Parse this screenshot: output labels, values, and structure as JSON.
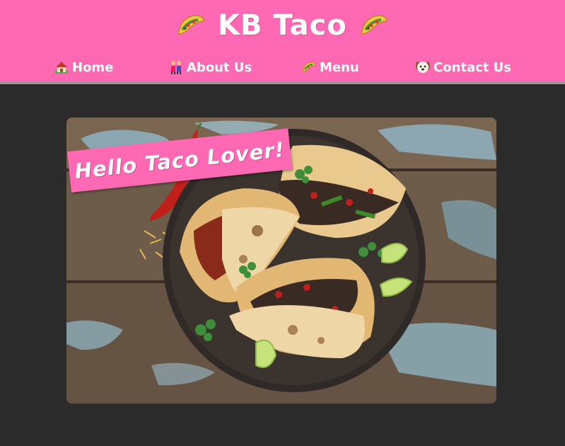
{
  "header": {
    "title": "KB Taco",
    "left_icon": "taco-icon",
    "right_icon": "taco-icon",
    "background_color": "#ff69b4"
  },
  "nav": {
    "items": [
      {
        "label": "Home",
        "icon": "house-icon"
      },
      {
        "label": "About Us",
        "icon": "people-icon"
      },
      {
        "label": "Menu",
        "icon": "taco-icon"
      },
      {
        "label": "Contact Us",
        "icon": "dog-face-icon"
      }
    ]
  },
  "hero": {
    "image": "tacos-on-plate-photo",
    "banner_text": "Hello Taco Lover!"
  },
  "colors": {
    "accent": "#ff69b4",
    "page_background": "#2b2b2b",
    "text": "#ffffff"
  }
}
